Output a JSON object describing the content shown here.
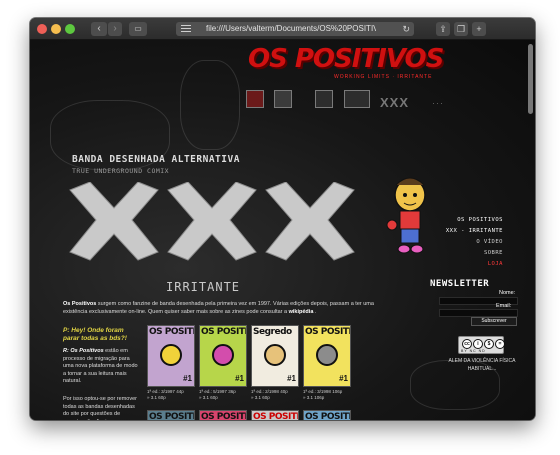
{
  "browser": {
    "url": "file:///Users/valterm/Documents/OS%20POSITIVOS",
    "back_icon": "‹",
    "forward_icon": "›",
    "reload_icon": "↻"
  },
  "site": {
    "logo": "OS POSITIVOS",
    "logo_sub": "WORKING LIMITS · IRRITANTE",
    "header_xxx": "XXX",
    "header_extra": "···"
  },
  "main": {
    "title": "BANDA DESENHADA ALTERNATIVA",
    "subtitle": "TRUE UNDERGROUND COMIX",
    "xxx_caption": "IRRITANTE",
    "intro_bold": "Os Positivos",
    "intro_text": " surgem como fanzine de banda desenhada pela primeira vez em 1997. Várias edições depois, passam a ter uma existência exclusivamente on-line. Quem quiser saber mais sobre as zines pode consultar a ",
    "intro_link": "wikipédia",
    "intro_end": " .",
    "faq_question": "P: Hey! Onde foram parar todas as bds?!",
    "faq_answer_lead": "R: Os Positivos",
    "faq_answer": " estão em processo de migração para uma nova plataforma de modo a tornar a sua leitura mais natural.",
    "faq_answer2": "Por isso optou-se por remover todas as bandas desenhadas do site por questões de manutenção. Assim que a migração esteja completa"
  },
  "covers": [
    {
      "title": "OS POSITIVOS",
      "no": "#1",
      "caption": "1ª ed.: 3/1997 44p",
      "price": "» 3.1 60p",
      "bg": "#c2a4cf",
      "title_color": "#111",
      "blob": "#f1d23a"
    },
    {
      "title": "OS POSITIVOS",
      "no": "#1",
      "caption": "1ª ed.: 5/1997 36p",
      "price": "» 3.1 60p",
      "bg": "#b7d64a",
      "title_color": "#111",
      "blob": "#d34dac"
    },
    {
      "title": "Segredo",
      "no": "#1",
      "caption": "1ª ed.: 2/1998 40p",
      "price": "» 3.1 60p",
      "bg": "#f1ece0",
      "title_color": "#111",
      "blob": "#e7c27a"
    },
    {
      "title": "OS POSITIVOS",
      "no": "#1",
      "caption": "1ª ed.: 3/1998 106p",
      "price": "» 3.1 106p",
      "bg": "#f2e25e",
      "title_color": "#111",
      "blob": "#8c8c8c"
    },
    {
      "title": "OS POSITIVOS",
      "no": "",
      "caption": "",
      "price": "",
      "bg": "#5b7e8e",
      "title_color": "#111",
      "blob": "#c55"
    },
    {
      "title": "OS POSITIVOS",
      "no": "",
      "caption": "",
      "price": "",
      "bg": "#d8446d",
      "title_color": "#111",
      "blob": "#444"
    },
    {
      "title": "OS POSITIVOS",
      "no": "",
      "caption": "",
      "price": "",
      "bg": "#c9c9c9",
      "title_color": "#c00",
      "blob": "#777"
    },
    {
      "title": "OS POSITIVOS",
      "no": "",
      "caption": "",
      "price": "",
      "bg": "#6fa4c9",
      "title_color": "#111",
      "blob": "#f6b4c9"
    }
  ],
  "nav": {
    "heading": "OS POSITIVOS",
    "items": [
      {
        "label": "XXX - IRRITANTE"
      },
      {
        "label": "O VÍDEO"
      },
      {
        "label": "SOBRE"
      },
      {
        "label": "LOJA"
      }
    ]
  },
  "newsletter": {
    "title": "NEWSLETTER",
    "name_label": "Nome:",
    "email_label": "Email:",
    "submit_label": "Subscrever"
  },
  "license": {
    "badge_text": "BY   NC   ND",
    "note": "ALEM DA VIOLÊNCIA FÍSICA HABITUAL..."
  },
  "colors": {
    "accent_red": "#d01010",
    "faq_yellow": "#e2d544",
    "background": "#161616"
  }
}
